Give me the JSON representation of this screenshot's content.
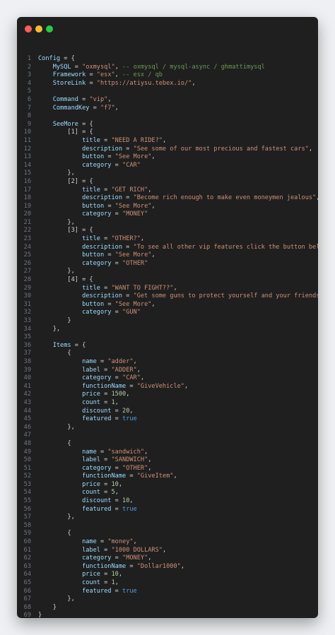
{
  "window": {
    "controls": [
      "close",
      "minimize",
      "maximize"
    ]
  },
  "colors": {
    "background": "#1f1f1f",
    "keyword": "#9cdcfe",
    "string": "#ce9178",
    "comment": "#6a9955",
    "number": "#b5cea8",
    "boolean": "#569cd6"
  },
  "lines": [
    [
      [
        "k",
        "Config"
      ],
      [
        "p",
        " = {"
      ]
    ],
    [
      [
        "k",
        "    MySQL"
      ],
      [
        "p",
        " = "
      ],
      [
        "s",
        "\"oxmysql\""
      ],
      [
        "p",
        ", "
      ],
      [
        "c",
        "-- oxmysql / mysql-async / ghmattimysql"
      ]
    ],
    [
      [
        "k",
        "    Framework"
      ],
      [
        "p",
        " = "
      ],
      [
        "s",
        "\"esx\""
      ],
      [
        "p",
        ", "
      ],
      [
        "c",
        "-- esx / qb"
      ]
    ],
    [
      [
        "k",
        "    StoreLink"
      ],
      [
        "p",
        " = "
      ],
      [
        "s",
        "\"https://atiysu.tebex.io/\""
      ],
      [
        "p",
        ","
      ]
    ],
    [
      [
        "p",
        ""
      ]
    ],
    [
      [
        "k",
        "    Command"
      ],
      [
        "p",
        " = "
      ],
      [
        "s",
        "\"vip\""
      ],
      [
        "p",
        ","
      ]
    ],
    [
      [
        "k",
        "    CommandKey"
      ],
      [
        "p",
        " = "
      ],
      [
        "s",
        "\"f7\""
      ],
      [
        "p",
        ","
      ]
    ],
    [
      [
        "p",
        ""
      ]
    ],
    [
      [
        "k",
        "    SeeMore"
      ],
      [
        "p",
        " = {"
      ]
    ],
    [
      [
        "p",
        "        [1] = {"
      ]
    ],
    [
      [
        "k",
        "            title"
      ],
      [
        "p",
        " = "
      ],
      [
        "s",
        "\"NEED A RIDE?\""
      ],
      [
        "p",
        ","
      ]
    ],
    [
      [
        "k",
        "            description"
      ],
      [
        "p",
        " = "
      ],
      [
        "s",
        "\"See some of our most precious and fastest cars\""
      ],
      [
        "p",
        ","
      ]
    ],
    [
      [
        "k",
        "            button"
      ],
      [
        "p",
        " = "
      ],
      [
        "s",
        "\"See More\""
      ],
      [
        "p",
        ","
      ]
    ],
    [
      [
        "k",
        "            category"
      ],
      [
        "p",
        " = "
      ],
      [
        "s",
        "\"CAR\""
      ]
    ],
    [
      [
        "p",
        "        },"
      ]
    ],
    [
      [
        "p",
        "        [2] = {"
      ]
    ],
    [
      [
        "k",
        "            title"
      ],
      [
        "p",
        " = "
      ],
      [
        "s",
        "\"GET RICH\""
      ],
      [
        "p",
        ","
      ]
    ],
    [
      [
        "k",
        "            description"
      ],
      [
        "p",
        " = "
      ],
      [
        "s",
        "\"Become rich enough to make even moneymen jealous\""
      ],
      [
        "p",
        ","
      ]
    ],
    [
      [
        "k",
        "            button"
      ],
      [
        "p",
        " = "
      ],
      [
        "s",
        "\"See More\""
      ],
      [
        "p",
        ","
      ]
    ],
    [
      [
        "k",
        "            category"
      ],
      [
        "p",
        " = "
      ],
      [
        "s",
        "\"MONEY\""
      ]
    ],
    [
      [
        "p",
        "        },"
      ]
    ],
    [
      [
        "p",
        "        [3] = {"
      ]
    ],
    [
      [
        "k",
        "            title"
      ],
      [
        "p",
        " = "
      ],
      [
        "s",
        "\"OTHER?\""
      ],
      [
        "p",
        ","
      ]
    ],
    [
      [
        "k",
        "            description"
      ],
      [
        "p",
        " = "
      ],
      [
        "s",
        "\"To see all other vip features click the button below\""
      ],
      [
        "p",
        ","
      ]
    ],
    [
      [
        "k",
        "            button"
      ],
      [
        "p",
        " = "
      ],
      [
        "s",
        "\"See More\""
      ],
      [
        "p",
        ","
      ]
    ],
    [
      [
        "k",
        "            category"
      ],
      [
        "p",
        " = "
      ],
      [
        "s",
        "\"OTHER\""
      ]
    ],
    [
      [
        "p",
        "        },"
      ]
    ],
    [
      [
        "p",
        "        [4] = {"
      ]
    ],
    [
      [
        "k",
        "            title"
      ],
      [
        "p",
        " = "
      ],
      [
        "s",
        "\"WANT TO FIGHT??\""
      ],
      [
        "p",
        ","
      ]
    ],
    [
      [
        "k",
        "            description"
      ],
      [
        "p",
        " = "
      ],
      [
        "s",
        "\"Get some guns to protect yourself and your friends!\""
      ],
      [
        "p",
        ","
      ]
    ],
    [
      [
        "k",
        "            button"
      ],
      [
        "p",
        " = "
      ],
      [
        "s",
        "\"See More\""
      ],
      [
        "p",
        ","
      ]
    ],
    [
      [
        "k",
        "            category"
      ],
      [
        "p",
        " = "
      ],
      [
        "s",
        "\"GUN\""
      ]
    ],
    [
      [
        "p",
        "        }"
      ]
    ],
    [
      [
        "p",
        "    },"
      ]
    ],
    [
      [
        "p",
        ""
      ]
    ],
    [
      [
        "k",
        "    Items"
      ],
      [
        "p",
        " = {"
      ]
    ],
    [
      [
        "p",
        "        {"
      ]
    ],
    [
      [
        "k",
        "            name"
      ],
      [
        "p",
        " = "
      ],
      [
        "s",
        "\"adder\""
      ],
      [
        "p",
        ","
      ]
    ],
    [
      [
        "k",
        "            label"
      ],
      [
        "p",
        " = "
      ],
      [
        "s",
        "\"ADDER\""
      ],
      [
        "p",
        ","
      ]
    ],
    [
      [
        "k",
        "            category"
      ],
      [
        "p",
        " = "
      ],
      [
        "s",
        "\"CAR\""
      ],
      [
        "p",
        ","
      ]
    ],
    [
      [
        "k",
        "            functionName"
      ],
      [
        "p",
        " = "
      ],
      [
        "s",
        "\"GiveVehicle\""
      ],
      [
        "p",
        ","
      ]
    ],
    [
      [
        "k",
        "            price"
      ],
      [
        "p",
        " = "
      ],
      [
        "n",
        "1500"
      ],
      [
        "p",
        ","
      ]
    ],
    [
      [
        "k",
        "            count"
      ],
      [
        "p",
        " = "
      ],
      [
        "n",
        "1"
      ],
      [
        "p",
        ","
      ]
    ],
    [
      [
        "k",
        "            discount"
      ],
      [
        "p",
        " = "
      ],
      [
        "n",
        "20"
      ],
      [
        "p",
        ","
      ]
    ],
    [
      [
        "k",
        "            featured"
      ],
      [
        "p",
        " = "
      ],
      [
        "b",
        "true"
      ]
    ],
    [
      [
        "p",
        "        },"
      ]
    ],
    [
      [
        "p",
        ""
      ]
    ],
    [
      [
        "p",
        "        {"
      ]
    ],
    [
      [
        "k",
        "            name"
      ],
      [
        "p",
        " = "
      ],
      [
        "s",
        "\"sandwich\""
      ],
      [
        "p",
        ","
      ]
    ],
    [
      [
        "k",
        "            label"
      ],
      [
        "p",
        " = "
      ],
      [
        "s",
        "\"SANDWICH\""
      ],
      [
        "p",
        ","
      ]
    ],
    [
      [
        "k",
        "            category"
      ],
      [
        "p",
        " = "
      ],
      [
        "s",
        "\"OTHER\""
      ],
      [
        "p",
        ","
      ]
    ],
    [
      [
        "k",
        "            functionName"
      ],
      [
        "p",
        " = "
      ],
      [
        "s",
        "\"GiveItem\""
      ],
      [
        "p",
        ","
      ]
    ],
    [
      [
        "k",
        "            price"
      ],
      [
        "p",
        " = "
      ],
      [
        "n",
        "10"
      ],
      [
        "p",
        ","
      ]
    ],
    [
      [
        "k",
        "            count"
      ],
      [
        "p",
        " = "
      ],
      [
        "n",
        "5"
      ],
      [
        "p",
        ","
      ]
    ],
    [
      [
        "k",
        "            discount"
      ],
      [
        "p",
        " = "
      ],
      [
        "n",
        "10"
      ],
      [
        "p",
        ","
      ]
    ],
    [
      [
        "k",
        "            featured"
      ],
      [
        "p",
        " = "
      ],
      [
        "b",
        "true"
      ]
    ],
    [
      [
        "p",
        "        },"
      ]
    ],
    [
      [
        "p",
        ""
      ]
    ],
    [
      [
        "p",
        "        {"
      ]
    ],
    [
      [
        "k",
        "            name"
      ],
      [
        "p",
        " = "
      ],
      [
        "s",
        "\"money\""
      ],
      [
        "p",
        ","
      ]
    ],
    [
      [
        "k",
        "            label"
      ],
      [
        "p",
        " = "
      ],
      [
        "s",
        "\"1000 DOLLARS\""
      ],
      [
        "p",
        ","
      ]
    ],
    [
      [
        "k",
        "            category"
      ],
      [
        "p",
        " = "
      ],
      [
        "s",
        "\"MONEY\""
      ],
      [
        "p",
        ","
      ]
    ],
    [
      [
        "k",
        "            functionName"
      ],
      [
        "p",
        " = "
      ],
      [
        "s",
        "\"Dollar1000\""
      ],
      [
        "p",
        ","
      ]
    ],
    [
      [
        "k",
        "            price"
      ],
      [
        "p",
        " = "
      ],
      [
        "n",
        "10"
      ],
      [
        "p",
        ","
      ]
    ],
    [
      [
        "k",
        "            count"
      ],
      [
        "p",
        " = "
      ],
      [
        "n",
        "1"
      ],
      [
        "p",
        ","
      ]
    ],
    [
      [
        "k",
        "            featured"
      ],
      [
        "p",
        " = "
      ],
      [
        "b",
        "true"
      ]
    ],
    [
      [
        "p",
        "        },"
      ]
    ],
    [
      [
        "p",
        "    }"
      ]
    ],
    [
      [
        "p",
        "}"
      ]
    ],
    [
      [
        "p",
        ""
      ]
    ]
  ]
}
